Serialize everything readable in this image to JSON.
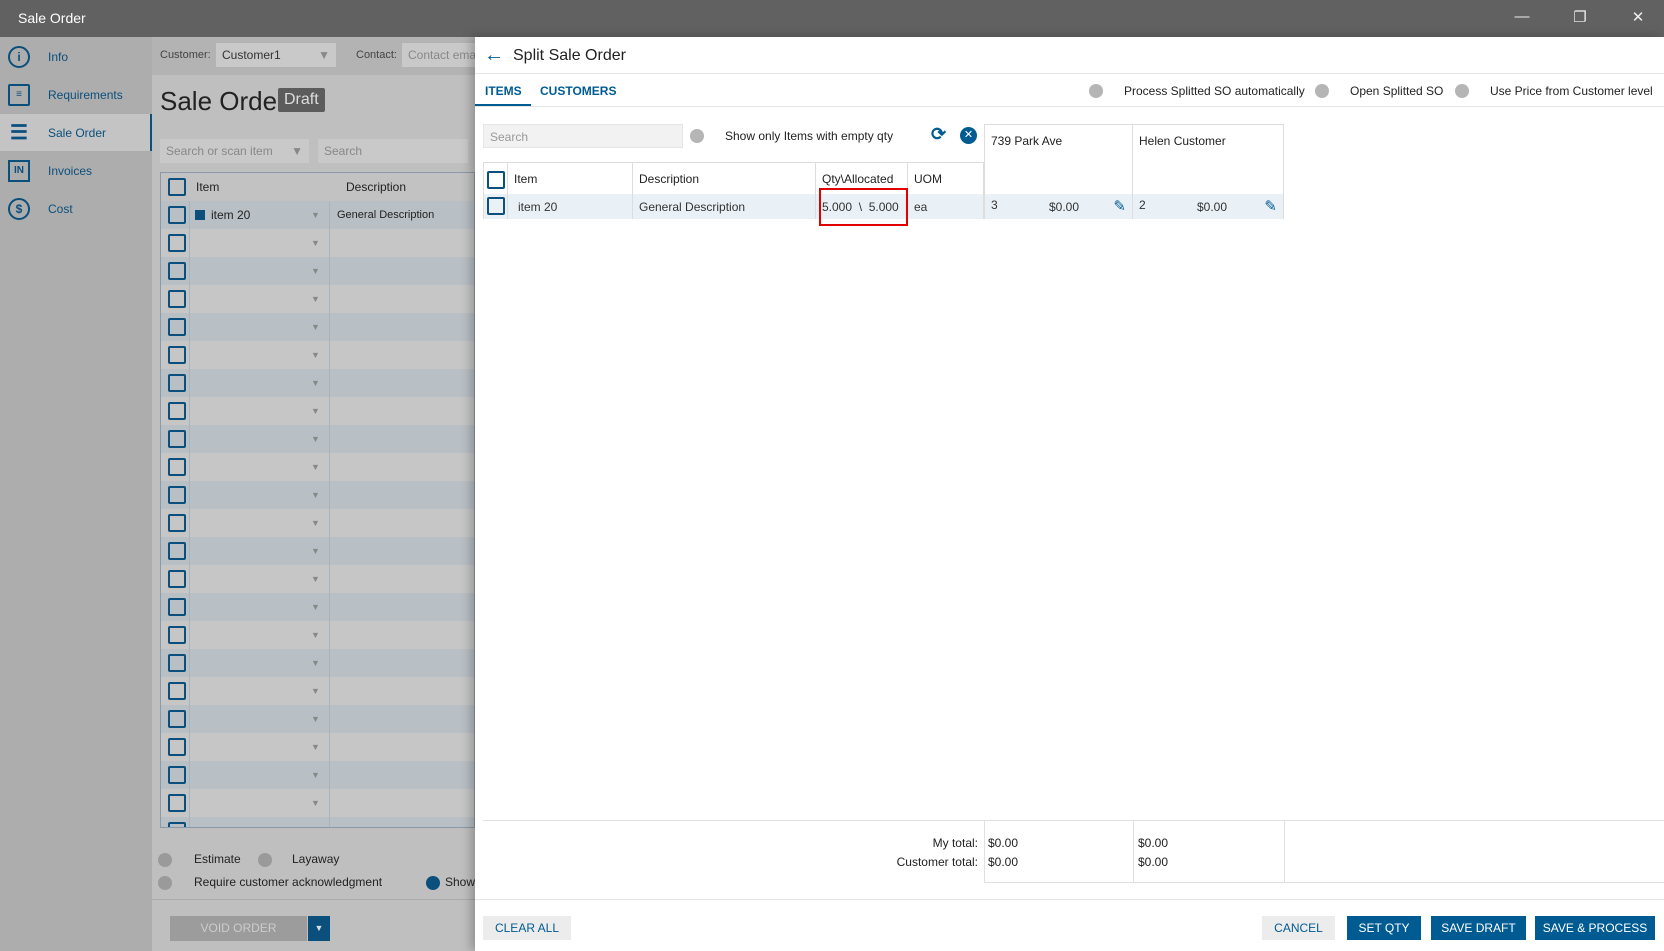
{
  "window": {
    "title": "Sale Order"
  },
  "sidebar": {
    "items": [
      {
        "label": "Info"
      },
      {
        "label": "Requirements"
      },
      {
        "label": "Sale Order"
      },
      {
        "label": "Invoices"
      },
      {
        "label": "Cost"
      }
    ]
  },
  "order": {
    "customer_label": "Customer:",
    "customer_value": "Customer1",
    "contact_label": "Contact:",
    "contact_placeholder": "Contact ema",
    "heading": "Sale Order",
    "status": "Draft",
    "search_item_placeholder": "Search or scan item",
    "search_placeholder": "Search",
    "col_item": "Item",
    "col_description": "Description",
    "rows": [
      {
        "item": "item 20",
        "description": "General Description"
      },
      {},
      {},
      {},
      {},
      {},
      {},
      {},
      {},
      {},
      {},
      {},
      {},
      {},
      {},
      {},
      {},
      {},
      {},
      {},
      {},
      {},
      {}
    ],
    "toggles": {
      "estimate": "Estimate",
      "layaway": "Layaway",
      "require_ack": "Require customer acknowledgment",
      "show": "Show"
    },
    "void_label": "VOID ORDER"
  },
  "split": {
    "title": "Split Sale Order",
    "tabs": [
      "ITEMS",
      "CUSTOMERS"
    ],
    "options": [
      "Process Splitted SO automatically",
      "Open Splitted SO",
      "Use Price from Customer level"
    ],
    "search_placeholder": "Search",
    "empty_qty_label": "Show only Items with empty qty",
    "columns": [
      "Item",
      "Description",
      "Qty\\Allocated",
      "UOM"
    ],
    "customers": [
      {
        "name": "739 Park Ave",
        "qty": "3",
        "price": "$0.00",
        "my_total": "$0.00",
        "customer_total": "$0.00"
      },
      {
        "name": "Helen Customer",
        "qty": "2",
        "price": "$0.00",
        "my_total": "$0.00",
        "customer_total": "$0.00"
      }
    ],
    "row": {
      "item": "item 20",
      "description": "General Description",
      "qty": "5.000  \\  5.000",
      "uom": "ea"
    },
    "my_total_label": "My total:",
    "customer_total_label": "Customer total:",
    "buttons": {
      "clear_all": "CLEAR ALL",
      "cancel": "CANCEL",
      "set_qty": "SET QTY",
      "save_draft": "SAVE DRAFT",
      "save_process": "SAVE & PROCESS"
    }
  },
  "colors": {
    "accent": "#005b92",
    "highlight": "#e00000"
  }
}
